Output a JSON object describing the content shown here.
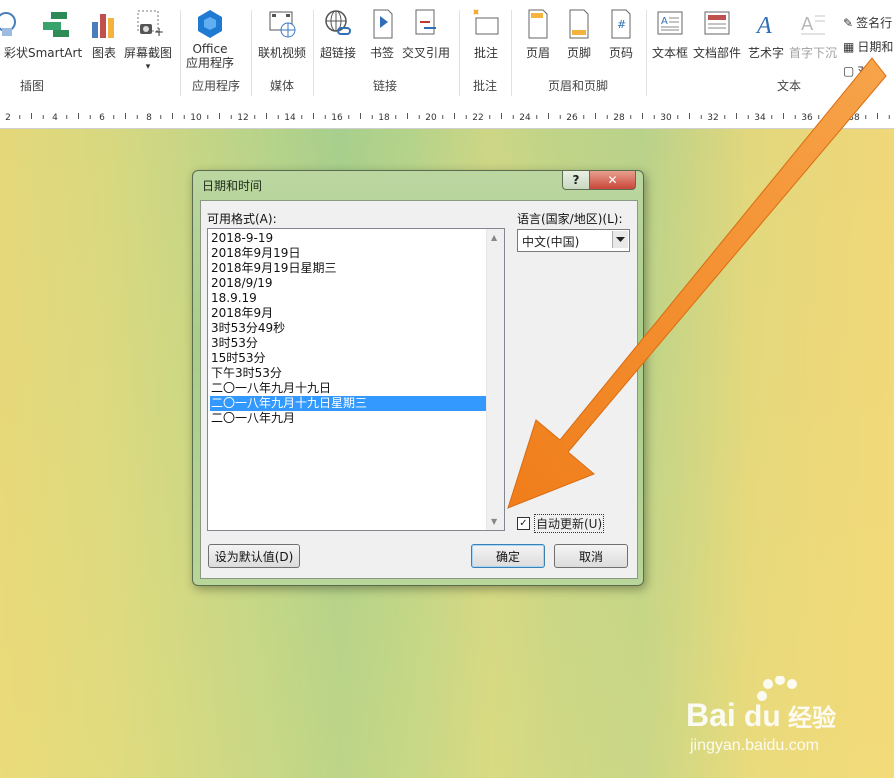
{
  "ribbon": {
    "groups": {
      "illustrations": {
        "label": "插图",
        "shapes": "彩状",
        "smartart": "SmartArt",
        "chart": "图表",
        "screenshot": "屏幕截图"
      },
      "apps": {
        "label": "应用程序",
        "office_line1": "Office",
        "office_line2": "应用程序"
      },
      "media": {
        "label": "媒体",
        "online_video": "联机视频"
      },
      "links": {
        "label": "链接",
        "hyperlink": "超链接",
        "bookmark": "书签",
        "crossref": "交叉引用"
      },
      "comments": {
        "label": "批注",
        "comment": "批注"
      },
      "header_footer": {
        "label": "页眉和页脚",
        "header": "页眉",
        "footer": "页脚",
        "page_number": "页码"
      },
      "text": {
        "label": "文本",
        "textbox": "文本框",
        "quickparts": "文档部件",
        "wordart": "艺术字",
        "dropcap": "首字下沉",
        "signature": "签名行",
        "datetime": "日期和",
        "object": "对象"
      }
    }
  },
  "ruler": {
    "ticks": [
      "2",
      "4",
      "6",
      "8",
      "10",
      "12",
      "14",
      "16",
      "18",
      "20",
      "22",
      "24",
      "26",
      "28",
      "30",
      "32",
      "34",
      "36",
      "38"
    ]
  },
  "dialog": {
    "title": "日期和时间",
    "help": "?",
    "close": "✕",
    "formats_label": "可用格式(A):",
    "formats": [
      "2018-9-19",
      "2018年9月19日",
      "2018年9月19日星期三",
      "2018/9/19",
      "18.9.19",
      "2018年9月",
      "3时53分49秒",
      "3时53分",
      "15时53分",
      "下午3时53分",
      "二〇一八年九月十九日",
      "二〇一八年九月十九日星期三",
      "二〇一八年九月"
    ],
    "selected_index": 11,
    "language_label": "语言(国家/地区)(L):",
    "language_value": "中文(中国)",
    "auto_update_label": "自动更新(U)",
    "auto_update_checked": true,
    "set_default": "设为默认值(D)",
    "ok": "确定",
    "cancel": "取消"
  },
  "watermark": {
    "brand": "Bai",
    "brand2": "经验",
    "url": "jingyan.baidu.com"
  },
  "colors": {
    "arrow": "#f08a24",
    "selection": "#3399ff"
  }
}
